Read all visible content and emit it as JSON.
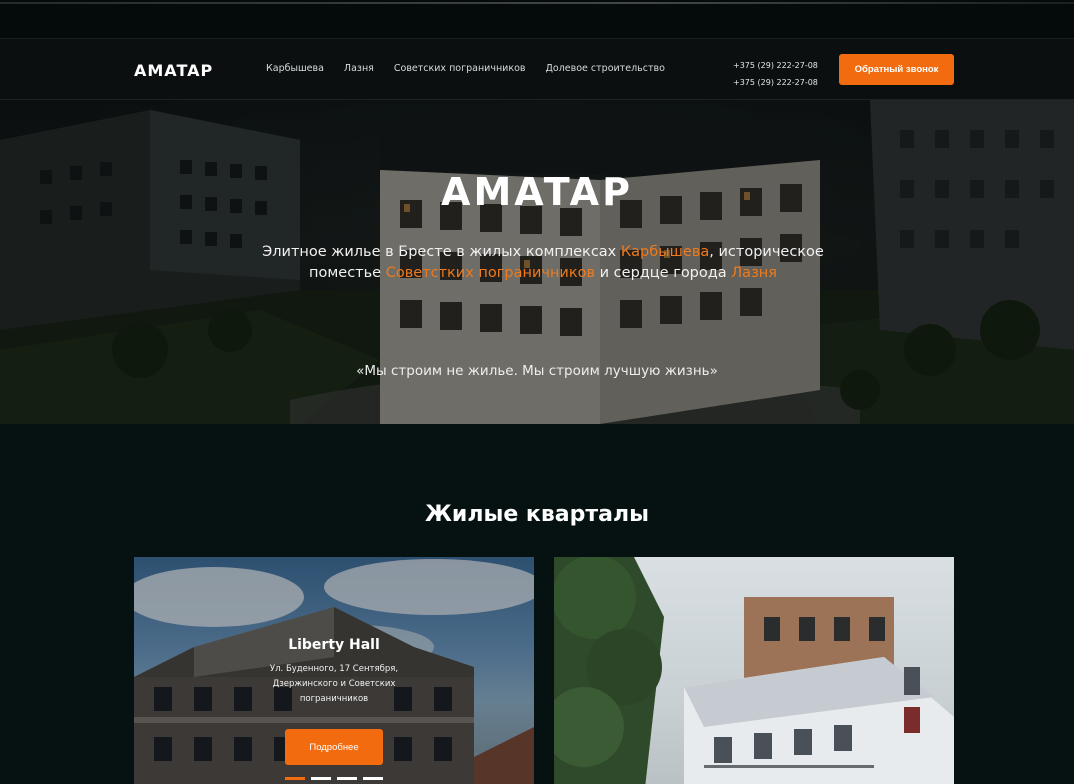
{
  "header": {
    "logo": "AMATAP",
    "nav": [
      "Карбышева",
      "Лазня",
      "Советских пограничников",
      "Долевое строительство"
    ],
    "phones": [
      "+375 (29) 222-27-08",
      "+375 (29) 222-27-08"
    ],
    "callback_label": "Обратный звонок"
  },
  "hero": {
    "logo": "AMATAP",
    "desc_1": "Элитное жилье в Бресте в жилых комплексах ",
    "desc_link_1": "Карбышева",
    "desc_2": ", историческое поместье ",
    "desc_link_2": "Советстких пограничников",
    "desc_3": " и сердце города ",
    "desc_link_3": "Лазня",
    "quote": "«Мы строим не жилье. Мы строим лучшую жизнь»"
  },
  "section": {
    "title": "Жилые кварталы",
    "cards": [
      {
        "title": "Liberty Hall",
        "address": "Ул. Буденного, 17 Сентября, Дзержинского и Советских пограничников",
        "button": "Подробнее"
      }
    ]
  },
  "colors": {
    "accent": "#f26b0f",
    "background": "#061112"
  }
}
